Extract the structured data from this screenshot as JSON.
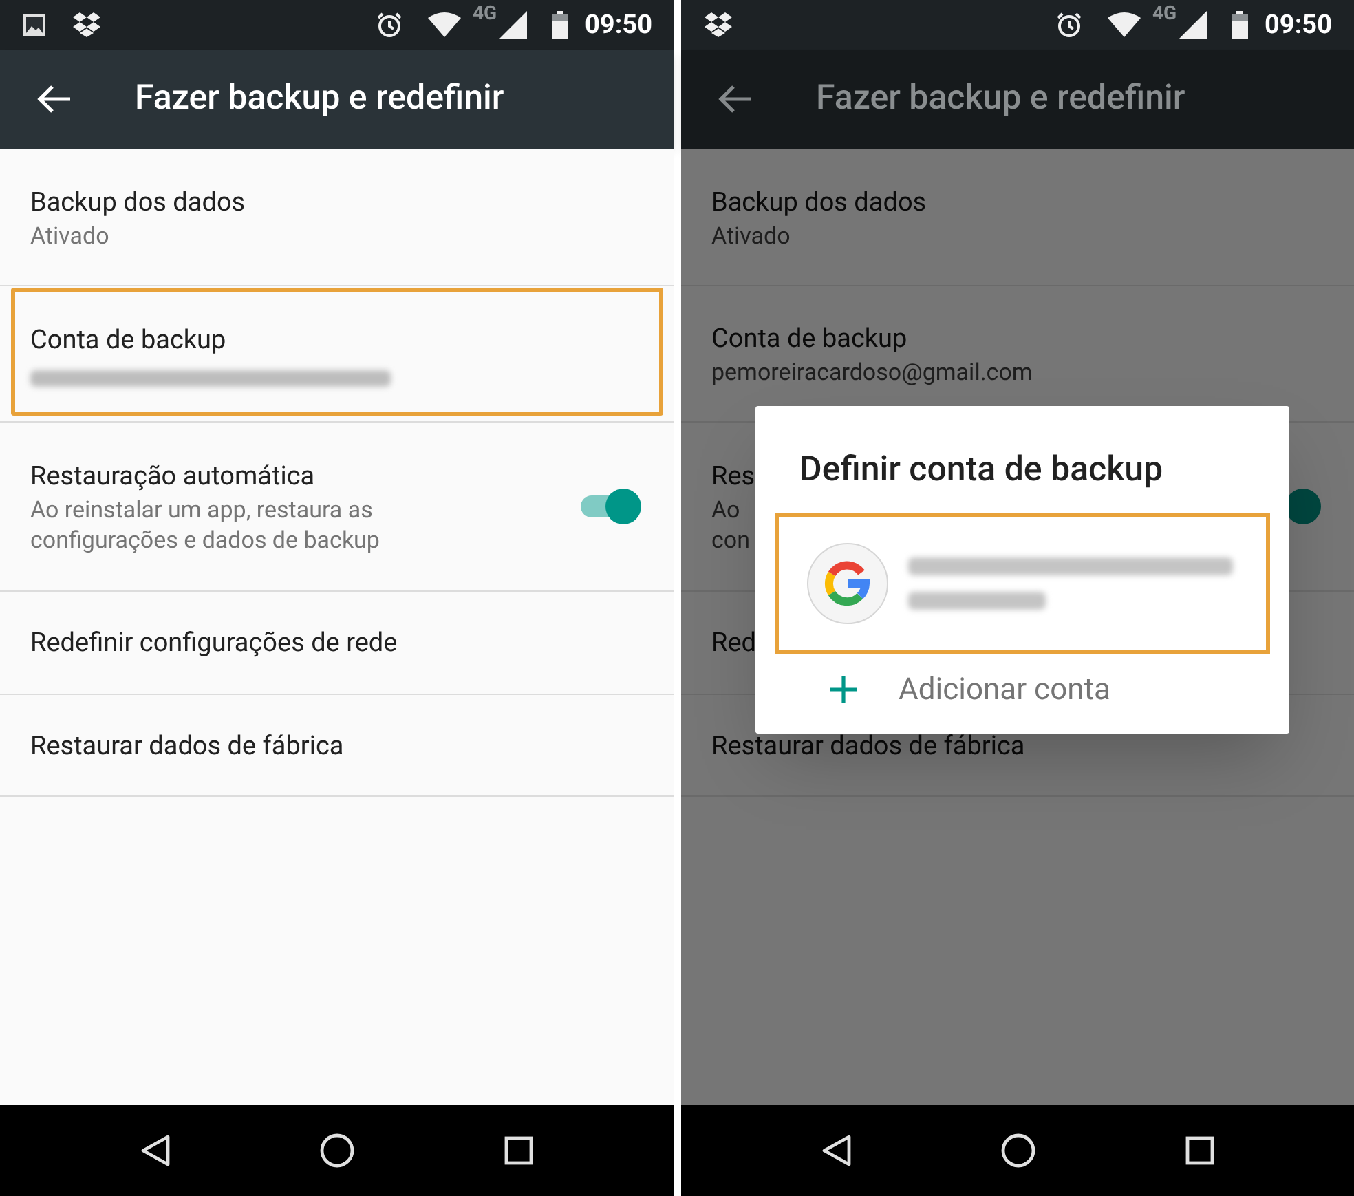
{
  "screens": [
    {
      "status_bar": {
        "notifications": [
          {
            "kind": "image"
          },
          {
            "kind": "box"
          }
        ],
        "network": "4G",
        "time": "09:50"
      },
      "app_bar": {
        "title": "Fazer backup e redefinir"
      },
      "dimmed": false,
      "settings": [
        {
          "kind": "text",
          "title": "Backup dos dados",
          "subtitle_lines": [
            "Ativado"
          ],
          "highlighted": false
        },
        {
          "kind": "blurred",
          "title": "Conta de backup",
          "highlighted": true
        },
        {
          "kind": "toggle",
          "title": "Restauração automática",
          "subtitle_lines": [
            "Ao reinstalar um app, restaura as",
            "configurações e dados de backup"
          ],
          "on": true,
          "highlighted": false
        },
        {
          "kind": "text",
          "title": "Redefinir configurações de rede",
          "highlighted": false
        },
        {
          "kind": "text",
          "title": "Restaurar dados de fábrica",
          "highlighted": false
        }
      ]
    },
    {
      "status_bar": {
        "notifications": [
          {
            "kind": "box"
          }
        ],
        "network": "4G",
        "time": "09:50"
      },
      "app_bar": {
        "title": "Fazer backup e redefinir"
      },
      "dimmed": true,
      "settings": [
        {
          "kind": "text",
          "title": "Backup dos dados",
          "subtitle_lines": [
            "Ativado"
          ],
          "highlighted": false
        },
        {
          "kind": "text",
          "title": "Conta de backup",
          "subtitle_lines": [
            "pemoreiracardoso@gmail.com"
          ],
          "highlighted": false
        },
        {
          "kind": "toggle",
          "title": "Res",
          "subtitle_lines": [
            "Ao",
            "con"
          ],
          "on": true,
          "highlighted": false
        },
        {
          "kind": "text",
          "title": "Red",
          "highlighted": false
        },
        {
          "kind": "text",
          "title": "Restaurar dados de fábrica",
          "highlighted": false
        }
      ],
      "dialog": {
        "title": "Definir conta de backup",
        "account": {
          "highlighted": true
        },
        "add_label": "Adicionar conta"
      }
    }
  ]
}
